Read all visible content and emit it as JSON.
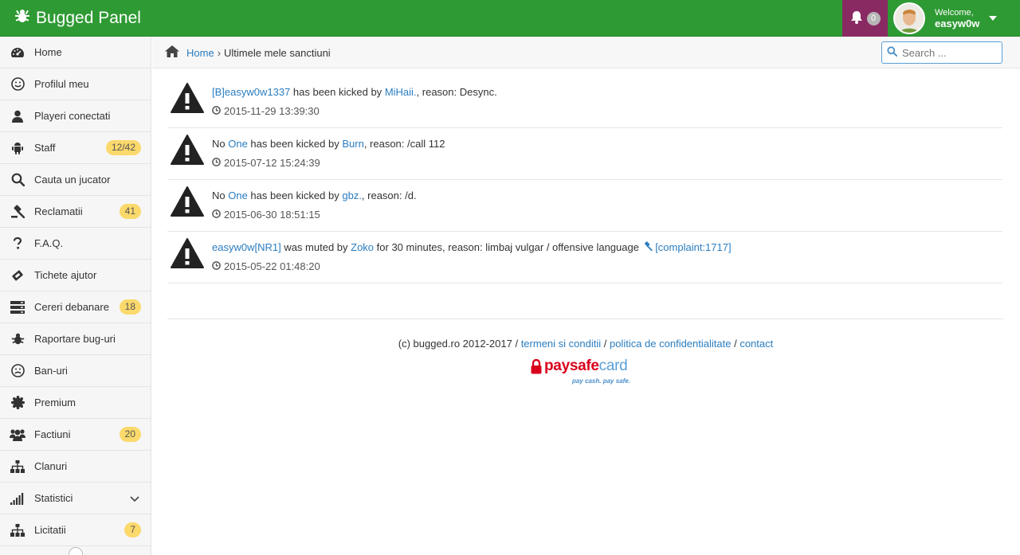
{
  "app": {
    "title": "Bugged Panel"
  },
  "notifications": {
    "count": "0"
  },
  "user": {
    "welcome": "Welcome,",
    "name": "easyw0w"
  },
  "sidebar": {
    "items": [
      {
        "label": "Home",
        "icon": "dashboard-icon",
        "badge": ""
      },
      {
        "label": "Profilul meu",
        "icon": "smile-icon",
        "badge": ""
      },
      {
        "label": "Playeri conectati",
        "icon": "user-icon",
        "badge": ""
      },
      {
        "label": "Staff",
        "icon": "android-icon",
        "badge": "12/42"
      },
      {
        "label": "Cauta un jucator",
        "icon": "search-icon",
        "badge": ""
      },
      {
        "label": "Reclamatii",
        "icon": "gavel-icon",
        "badge": "41"
      },
      {
        "label": "F.A.Q.",
        "icon": "question-icon",
        "badge": ""
      },
      {
        "label": "Tichete ajutor",
        "icon": "ticket-icon",
        "badge": ""
      },
      {
        "label": "Cereri debanare",
        "icon": "server-icon",
        "badge": "18"
      },
      {
        "label": "Raportare bug-uri",
        "icon": "bug-icon",
        "badge": ""
      },
      {
        "label": "Ban-uri",
        "icon": "frown-icon",
        "badge": ""
      },
      {
        "label": "Premium",
        "icon": "certificate-icon",
        "badge": ""
      },
      {
        "label": "Factiuni",
        "icon": "users-icon",
        "badge": "20"
      },
      {
        "label": "Clanuri",
        "icon": "sitemap-icon",
        "badge": ""
      },
      {
        "label": "Statistici",
        "icon": "signal-icon",
        "badge": ""
      },
      {
        "label": "Licitatii",
        "icon": "sitemap-icon",
        "badge": "7"
      }
    ]
  },
  "breadcrumb": {
    "home": "Home",
    "separator": "›",
    "current": "Ultimele mele sanctiuni"
  },
  "search": {
    "placeholder": "Search ..."
  },
  "sanctions": [
    {
      "pre": "",
      "player": "[B]easyw0w1337",
      "action": " has been kicked by ",
      "admin": "MiHaii.",
      "reason": ", reason: Desync.",
      "extra": "",
      "time": "2015-11-29 13:39:30"
    },
    {
      "pre": "No ",
      "player": "One",
      "action": " has been kicked by ",
      "admin": "Burn",
      "reason": ", reason: /call 112",
      "extra": "",
      "time": "2015-07-12 15:24:39"
    },
    {
      "pre": "No ",
      "player": "One",
      "action": " has been kicked by ",
      "admin": "gbz.",
      "reason": ", reason: /d.",
      "extra": "",
      "time": "2015-06-30 18:51:15"
    },
    {
      "pre": "",
      "player": "easyw0w[NR1]",
      "action": " was muted by ",
      "admin": "Zoko",
      "reason": " for 30 minutes, reason: limbaj vulgar / offensive language ",
      "extra": "[complaint:1717]",
      "time": "2015-05-22 01:48:20"
    }
  ],
  "footer": {
    "copyright": "(c) bugged.ro 2012-2017 / ",
    "terms": "termeni si conditii",
    "sep1": " / ",
    "privacy": "politica de confidentialitate",
    "sep2": " / ",
    "contact": "contact"
  },
  "paysafe": {
    "brand_a": "paysafe",
    "brand_b": "card",
    "tagline": "pay cash. pay safe."
  },
  "colors": {
    "topbar": "#2e9a33",
    "notif": "#8a2a62",
    "link": "#2a7dc0",
    "badge": "#fbd96b"
  }
}
